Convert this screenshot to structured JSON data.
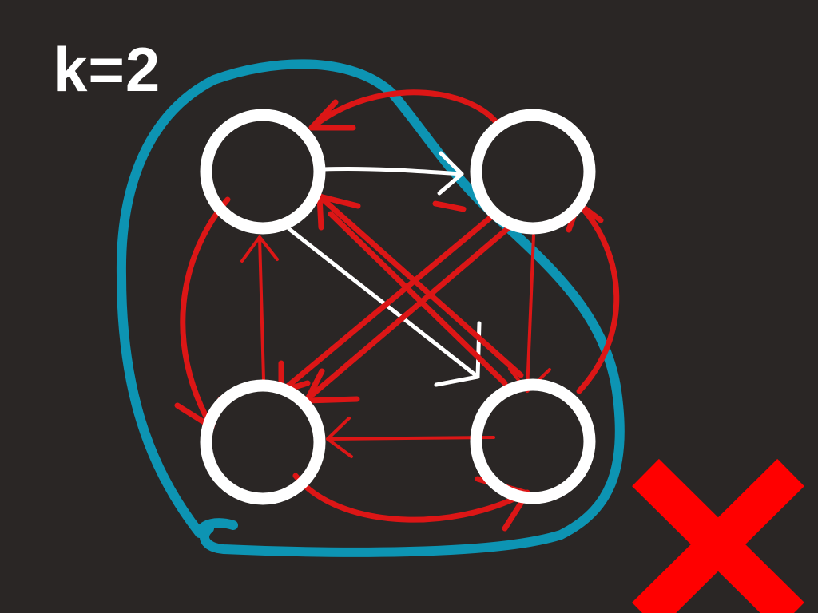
{
  "label": "k=2",
  "colors": {
    "background": "#2a2625",
    "node": "#ffffff",
    "edge_white": "#ffffff",
    "edge_red": "#dc1616",
    "lasso": "#0d94b3",
    "reject_mark": "#ff0000",
    "label": "#ffffff"
  },
  "icons": {
    "reject_mark": "x-mark-icon"
  }
}
